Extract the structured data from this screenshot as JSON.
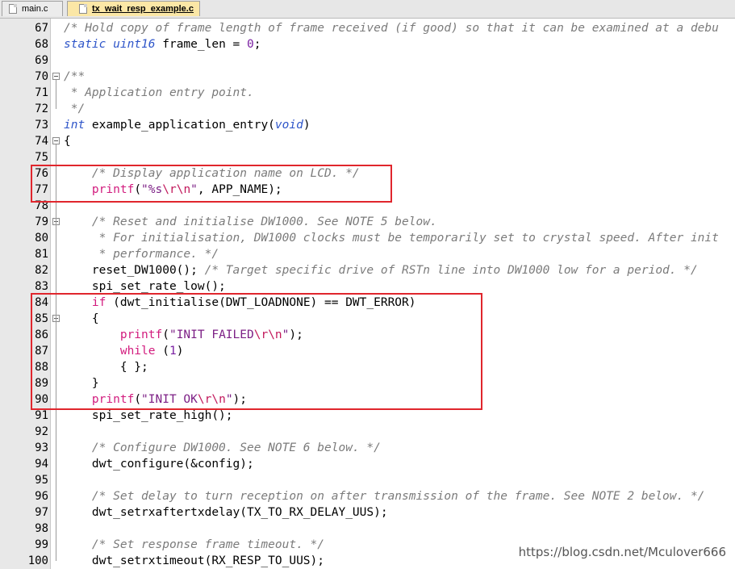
{
  "tabs": [
    {
      "label": "main.c",
      "active": false
    },
    {
      "label": "tx_wait_resp_example.c",
      "active": true
    }
  ],
  "editor": {
    "lines": [
      {
        "num": "67",
        "fold": "",
        "tokens": [
          {
            "t": "/* Hold copy of frame length of frame received (if good) so that it can be examined at a debu",
            "c": "comment"
          }
        ]
      },
      {
        "num": "68",
        "fold": "",
        "tokens": [
          {
            "t": "static ",
            "c": "keyword"
          },
          {
            "t": "uint16",
            "c": "keyword"
          },
          {
            "t": " frame_len = ",
            "c": "plain"
          },
          {
            "t": "0",
            "c": "number"
          },
          {
            "t": ";",
            "c": "plain"
          }
        ]
      },
      {
        "num": "69",
        "fold": "",
        "tokens": []
      },
      {
        "num": "70",
        "fold": "box",
        "tokens": [
          {
            "t": "/**",
            "c": "comment"
          }
        ]
      },
      {
        "num": "71",
        "fold": "",
        "tokens": [
          {
            "t": " * Application entry point.",
            "c": "comment"
          }
        ]
      },
      {
        "num": "72",
        "fold": "",
        "tokens": [
          {
            "t": " */",
            "c": "comment"
          }
        ]
      },
      {
        "num": "73",
        "fold": "",
        "tokens": [
          {
            "t": "int",
            "c": "keyword"
          },
          {
            "t": " example_application_entry(",
            "c": "plain"
          },
          {
            "t": "void",
            "c": "keyword"
          },
          {
            "t": ")",
            "c": "plain"
          }
        ]
      },
      {
        "num": "74",
        "fold": "box",
        "tokens": [
          {
            "t": "{",
            "c": "plain"
          }
        ]
      },
      {
        "num": "75",
        "fold": "",
        "tokens": []
      },
      {
        "num": "76",
        "fold": "",
        "tokens": [
          {
            "t": "    /* Display application name on LCD. */",
            "c": "comment"
          }
        ]
      },
      {
        "num": "77",
        "fold": "",
        "tokens": [
          {
            "t": "    ",
            "c": "plain"
          },
          {
            "t": "printf",
            "c": "func"
          },
          {
            "t": "(",
            "c": "plain"
          },
          {
            "t": "\"%s",
            "c": "string"
          },
          {
            "t": "\\r\\n",
            "c": "escape"
          },
          {
            "t": "\"",
            "c": "string"
          },
          {
            "t": ", APP_NAME);",
            "c": "plain"
          }
        ]
      },
      {
        "num": "78",
        "fold": "",
        "tokens": []
      },
      {
        "num": "79",
        "fold": "box",
        "tokens": [
          {
            "t": "    /* Reset and initialise DW1000. See NOTE 5 below.",
            "c": "comment"
          }
        ]
      },
      {
        "num": "80",
        "fold": "",
        "tokens": [
          {
            "t": "     * For initialisation, DW1000 clocks must be temporarily set to crystal speed. After init",
            "c": "comment"
          }
        ]
      },
      {
        "num": "81",
        "fold": "",
        "tokens": [
          {
            "t": "     * performance. */",
            "c": "comment"
          }
        ]
      },
      {
        "num": "82",
        "fold": "",
        "tokens": [
          {
            "t": "    reset_DW1000(); ",
            "c": "plain"
          },
          {
            "t": "/* Target specific drive of RSTn line into DW1000 low for a period. */",
            "c": "comment"
          }
        ]
      },
      {
        "num": "83",
        "fold": "",
        "tokens": [
          {
            "t": "    spi_set_rate_low();",
            "c": "plain"
          }
        ]
      },
      {
        "num": "84",
        "fold": "",
        "tokens": [
          {
            "t": "    ",
            "c": "plain"
          },
          {
            "t": "if",
            "c": "func"
          },
          {
            "t": " (dwt_initialise(DWT_LOADNONE) == DWT_ERROR)",
            "c": "plain"
          }
        ]
      },
      {
        "num": "85",
        "fold": "box",
        "tokens": [
          {
            "t": "    {",
            "c": "plain"
          }
        ]
      },
      {
        "num": "86",
        "fold": "",
        "tokens": [
          {
            "t": "        ",
            "c": "plain"
          },
          {
            "t": "printf",
            "c": "func"
          },
          {
            "t": "(",
            "c": "plain"
          },
          {
            "t": "\"INIT FAILED",
            "c": "string"
          },
          {
            "t": "\\r\\n",
            "c": "escape"
          },
          {
            "t": "\"",
            "c": "string"
          },
          {
            "t": ");",
            "c": "plain"
          }
        ]
      },
      {
        "num": "87",
        "fold": "",
        "tokens": [
          {
            "t": "        ",
            "c": "plain"
          },
          {
            "t": "while",
            "c": "func"
          },
          {
            "t": " (",
            "c": "plain"
          },
          {
            "t": "1",
            "c": "number"
          },
          {
            "t": ")",
            "c": "plain"
          }
        ]
      },
      {
        "num": "88",
        "fold": "",
        "tokens": [
          {
            "t": "        { };",
            "c": "plain"
          }
        ]
      },
      {
        "num": "89",
        "fold": "",
        "tokens": [
          {
            "t": "    }",
            "c": "plain"
          }
        ]
      },
      {
        "num": "90",
        "fold": "",
        "tokens": [
          {
            "t": "    ",
            "c": "plain"
          },
          {
            "t": "printf",
            "c": "func"
          },
          {
            "t": "(",
            "c": "plain"
          },
          {
            "t": "\"INIT OK",
            "c": "string"
          },
          {
            "t": "\\r\\n",
            "c": "escape"
          },
          {
            "t": "\"",
            "c": "string"
          },
          {
            "t": ");",
            "c": "plain"
          }
        ]
      },
      {
        "num": "91",
        "fold": "",
        "tokens": [
          {
            "t": "    spi_set_rate_high();",
            "c": "plain"
          }
        ]
      },
      {
        "num": "92",
        "fold": "",
        "tokens": []
      },
      {
        "num": "93",
        "fold": "",
        "tokens": [
          {
            "t": "    /* Configure DW1000. See NOTE 6 below. */",
            "c": "comment"
          }
        ]
      },
      {
        "num": "94",
        "fold": "",
        "tokens": [
          {
            "t": "    dwt_configure(&config);",
            "c": "plain"
          }
        ]
      },
      {
        "num": "95",
        "fold": "",
        "tokens": []
      },
      {
        "num": "96",
        "fold": "",
        "tokens": [
          {
            "t": "    /* Set delay to turn reception on after transmission of the frame. See NOTE 2 below. */",
            "c": "comment"
          }
        ]
      },
      {
        "num": "97",
        "fold": "",
        "tokens": [
          {
            "t": "    dwt_setrxaftertxdelay(TX_TO_RX_DELAY_UUS);",
            "c": "plain"
          }
        ]
      },
      {
        "num": "98",
        "fold": "",
        "tokens": []
      },
      {
        "num": "99",
        "fold": "",
        "tokens": [
          {
            "t": "    /* Set response frame timeout. */",
            "c": "comment"
          }
        ]
      },
      {
        "num": "100",
        "fold": "",
        "tokens": [
          {
            "t": "    dwt_setrxtimeout(RX_RESP_TO_UUS);",
            "c": "plain"
          }
        ]
      }
    ]
  },
  "watermark": "https://blog.csdn.net/Mculover666"
}
